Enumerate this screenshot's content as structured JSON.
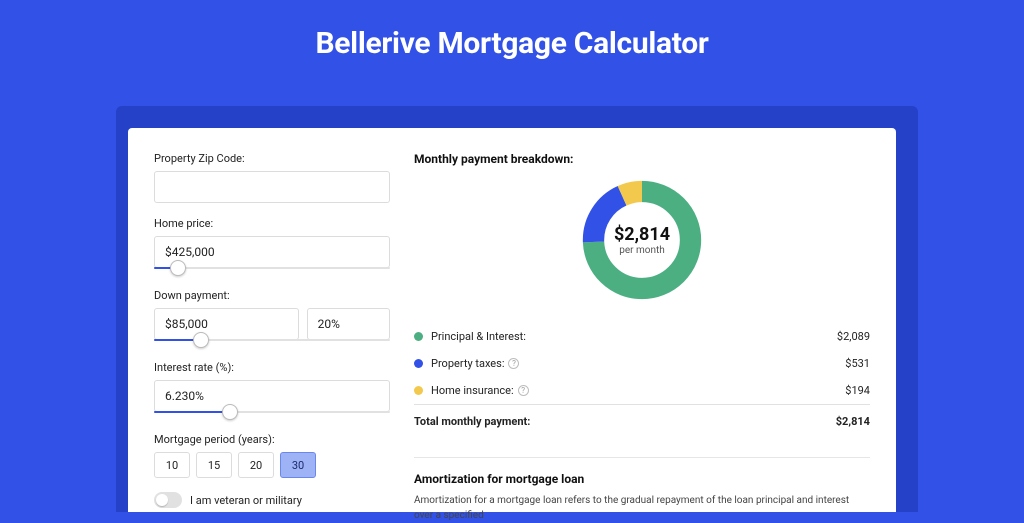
{
  "page_title": "Bellerive Mortgage Calculator",
  "form": {
    "zip_label": "Property Zip Code:",
    "zip_value": "",
    "home_price_label": "Home price:",
    "home_price_value": "$425,000",
    "home_price_slider_pct": 10,
    "down_payment_label": "Down payment:",
    "down_payment_value": "$85,000",
    "down_payment_pct_value": "20%",
    "down_payment_slider_pct": 20,
    "interest_label": "Interest rate (%):",
    "interest_value": "6.230%",
    "interest_slider_pct": 32,
    "period_label": "Mortgage period (years):",
    "periods": [
      "10",
      "15",
      "20",
      "30"
    ],
    "period_selected_index": 3,
    "veteran_label": "I am veteran or military",
    "veteran_on": false
  },
  "breakdown": {
    "title": "Monthly payment breakdown:",
    "center_value": "$2,814",
    "center_sub": "per month",
    "items": [
      {
        "label": "Principal & Interest:",
        "amount": "$2,089",
        "color": "#4caf82",
        "has_info": false
      },
      {
        "label": "Property taxes:",
        "amount": "$531",
        "color": "#3251e6",
        "has_info": true
      },
      {
        "label": "Home insurance:",
        "amount": "$194",
        "color": "#f2c94c",
        "has_info": true
      }
    ],
    "total_label": "Total monthly payment:",
    "total_amount": "$2,814"
  },
  "chart_data": {
    "type": "pie",
    "title": "Monthly payment breakdown:",
    "center_value": 2814,
    "center_unit": "per month",
    "series": [
      {
        "name": "Principal & Interest",
        "value": 2089,
        "color": "#4caf82"
      },
      {
        "name": "Property taxes",
        "value": 531,
        "color": "#3251e6"
      },
      {
        "name": "Home insurance",
        "value": 194,
        "color": "#f2c94c"
      }
    ]
  },
  "amort": {
    "title": "Amortization for mortgage loan",
    "text": "Amortization for a mortgage loan refers to the gradual repayment of the loan principal and interest over a specified"
  }
}
